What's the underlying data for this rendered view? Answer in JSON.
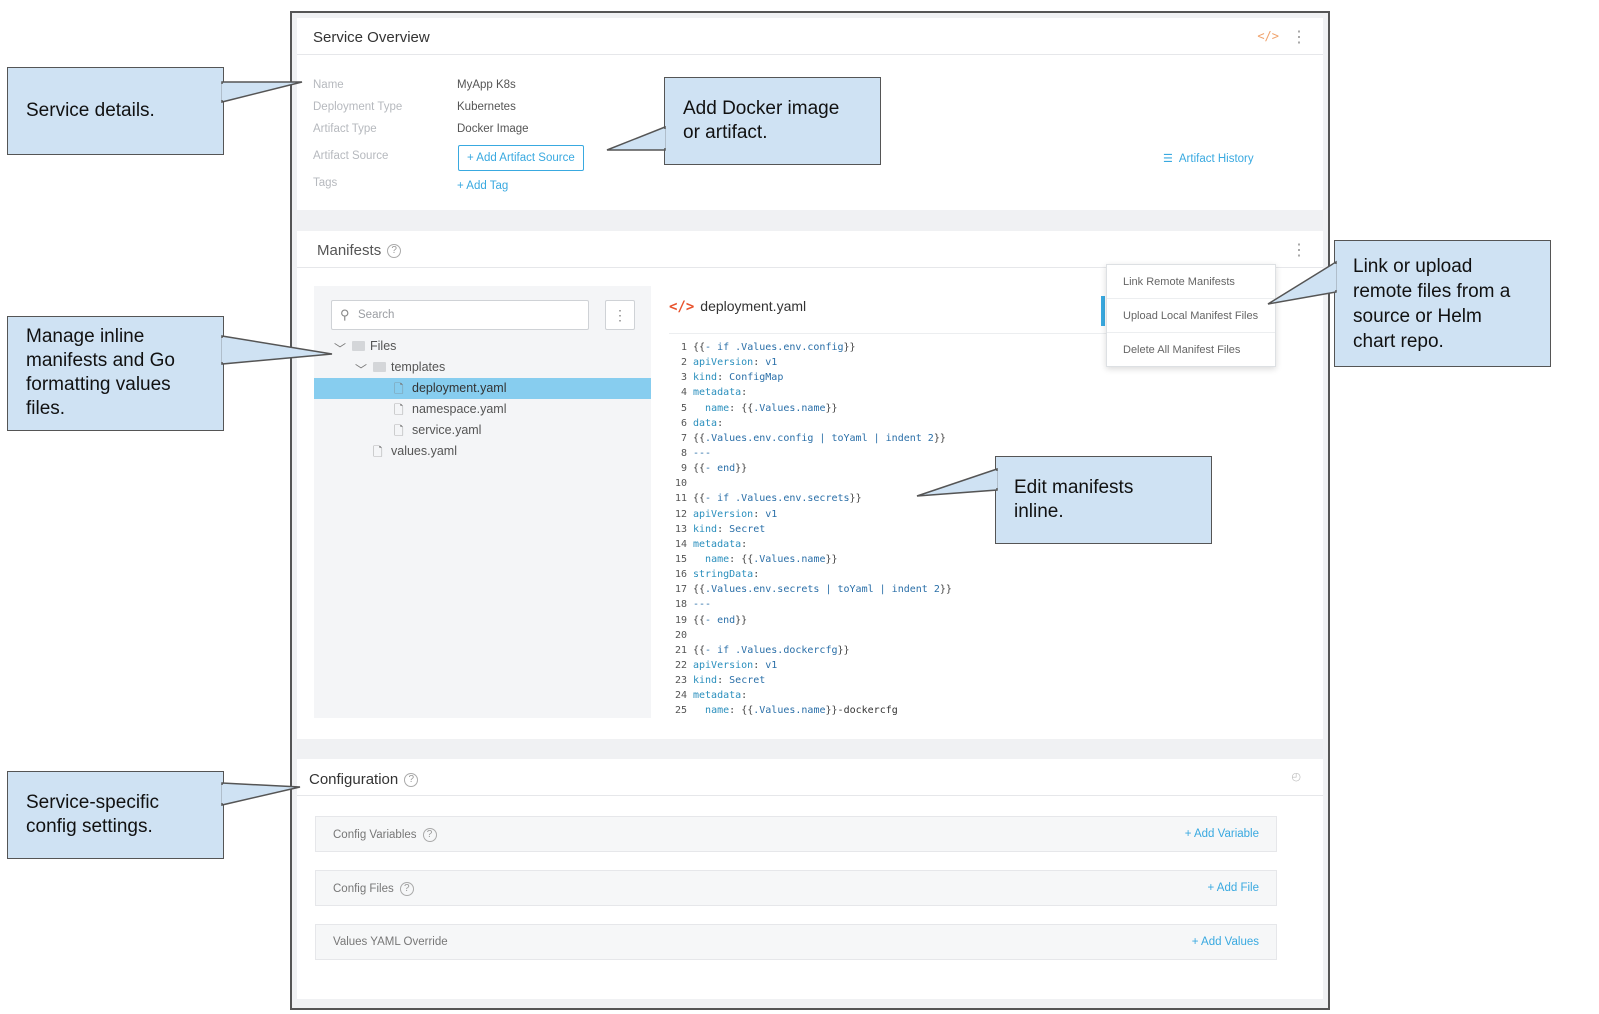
{
  "service_overview": {
    "title": "Service Overview",
    "code_icon": "code-icon",
    "details": [
      {
        "label": "Name",
        "value": "MyApp K8s"
      },
      {
        "label": "Deployment Type",
        "value": "Kubernetes"
      },
      {
        "label": "Artifact Type",
        "value": "Docker Image"
      }
    ],
    "artifact_source_label": "Artifact Source",
    "add_artifact_source": "+ Add Artifact Source",
    "tags_label": "Tags",
    "add_tag": "+ Add Tag",
    "artifact_history": "Artifact History"
  },
  "manifests": {
    "title": "Manifests",
    "search_placeholder": "Search",
    "tree": {
      "root": "Files",
      "folder": "templates",
      "files": [
        "deployment.yaml",
        "namespace.yaml",
        "service.yaml"
      ],
      "root_file": "values.yaml",
      "selected": "deployment.yaml"
    },
    "editor_title": "deployment.yaml",
    "menu": [
      "Link Remote Manifests",
      "Upload Local Manifest Files",
      "Delete All Manifest Files"
    ],
    "code_lines": [
      "{{- if .Values.env.config}}",
      "apiVersion: v1",
      "kind: ConfigMap",
      "metadata:",
      "  name: {{.Values.name}}",
      "data:",
      "{{.Values.env.config | toYaml | indent 2}}",
      "---",
      "{{- end}}",
      "",
      "{{- if .Values.env.secrets}}",
      "apiVersion: v1",
      "kind: Secret",
      "metadata:",
      "  name: {{.Values.name}}",
      "stringData:",
      "{{.Values.env.secrets | toYaml | indent 2}}",
      "---",
      "{{- end}}",
      "",
      "{{- if .Values.dockercfg}}",
      "apiVersion: v1",
      "kind: Secret",
      "metadata:",
      "  name: {{.Values.name}}-dockercfg"
    ]
  },
  "configuration": {
    "title": "Configuration",
    "rows": [
      {
        "label": "Config Variables",
        "action": "+ Add Variable",
        "help": true
      },
      {
        "label": "Config Files",
        "action": "+ Add File",
        "help": true
      },
      {
        "label": "Values YAML Override",
        "action": "+ Add Values",
        "help": false
      }
    ]
  },
  "callouts": {
    "service_details": "Service details.",
    "docker_image": [
      "Add Docker image",
      "or artifact."
    ],
    "manage_inline": [
      "Manage inline",
      "manifests and Go",
      "formatting values",
      "files."
    ],
    "link_upload": [
      "Link or upload",
      "remote files from a",
      "source or Helm",
      "chart repo."
    ],
    "edit_inline": [
      "Edit manifests",
      "inline."
    ],
    "service_config": [
      "Service-specific",
      "config settings."
    ]
  },
  "colors": {
    "accent": "#39a9e0",
    "callout_bg": "#cfe2f3",
    "selected_row": "#87cdef",
    "code_tag": "#e8522c"
  }
}
